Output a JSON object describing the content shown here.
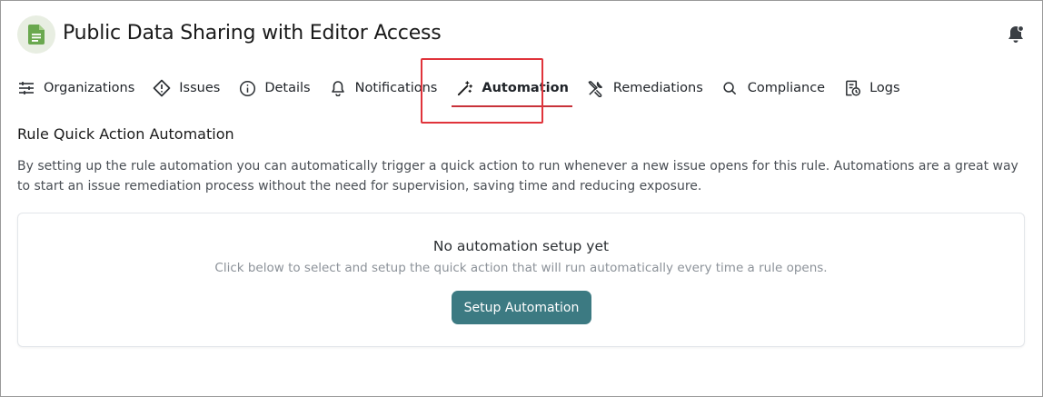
{
  "header": {
    "title": "Public Data Sharing with Editor Access",
    "app_icon": "google-sheets-doc-icon",
    "notification_icon": "bell-icon"
  },
  "tabs": [
    {
      "label": "Organizations",
      "icon": "sliders-icon",
      "active": false
    },
    {
      "label": "Issues",
      "icon": "warning-diamond-icon",
      "active": false
    },
    {
      "label": "Details",
      "icon": "info-icon",
      "active": false
    },
    {
      "label": "Notifications",
      "icon": "bell-icon",
      "active": false
    },
    {
      "label": "Automation",
      "icon": "magic-wand-icon",
      "active": true
    },
    {
      "label": "Remediations",
      "icon": "tools-icon",
      "active": false
    },
    {
      "label": "Compliance",
      "icon": "search-icon",
      "active": false
    },
    {
      "label": "Logs",
      "icon": "log-file-icon",
      "active": false
    }
  ],
  "section": {
    "title": "Rule Quick Action Automation",
    "description": "By setting up the rule automation you can automatically trigger a quick action to run whenever a new issue opens for this rule. Automations are a great way to start an issue remediation process without the need for supervision, saving time and reducing exposure."
  },
  "empty_state": {
    "title": "No automation setup yet",
    "subtitle": "Click below to select and setup the quick action that will run automatically every time a rule opens.",
    "button_label": "Setup Automation"
  },
  "colors": {
    "accent_button": "#3c7a82",
    "active_underline": "#c8323a",
    "highlight_box": "#e0343b",
    "app_icon_bg": "#e8eee2",
    "app_icon_fg": "#6aa84f"
  }
}
